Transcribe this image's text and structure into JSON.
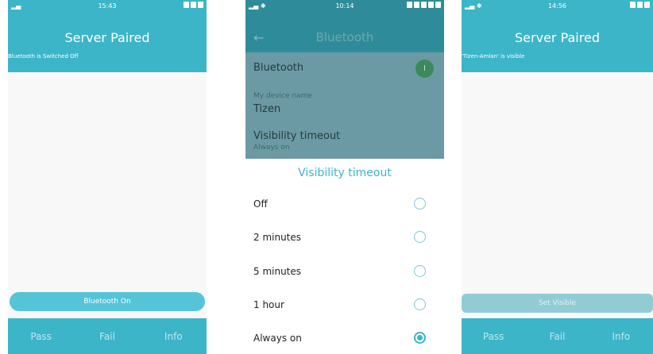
{
  "screens": [
    {
      "status_time": "15:43",
      "title": "Server Paired",
      "status_message": "Bluetooth is Switched Off",
      "action_button": "Bluetooth On",
      "bottom": {
        "pass": "Pass",
        "fail": "Fail",
        "info": "Info"
      }
    },
    {
      "status_time": "10:14",
      "settings_title": "Bluetooth",
      "bluetooth_label": "Bluetooth",
      "device_name_label": "My device name",
      "device_name_value": "Tizen",
      "visibility_label": "Visibility timeout",
      "visibility_value": "Always on",
      "dialog": {
        "title": "Visibility timeout",
        "options": [
          {
            "label": "Off",
            "selected": false
          },
          {
            "label": "2 minutes",
            "selected": false
          },
          {
            "label": "5 minutes",
            "selected": false
          },
          {
            "label": "1 hour",
            "selected": false
          },
          {
            "label": "Always on",
            "selected": true
          }
        ]
      }
    },
    {
      "status_time": "14:56",
      "title": "Server Paired",
      "status_message": "'Tizen-Amlan' is visible",
      "action_button": "Set Visible",
      "bottom": {
        "pass": "Pass",
        "fail": "Fail",
        "info": "Info"
      }
    }
  ],
  "colors": {
    "accent": "#3db5c9",
    "accent_light": "#55c4d8",
    "disabled_button": "#91ccd5"
  }
}
